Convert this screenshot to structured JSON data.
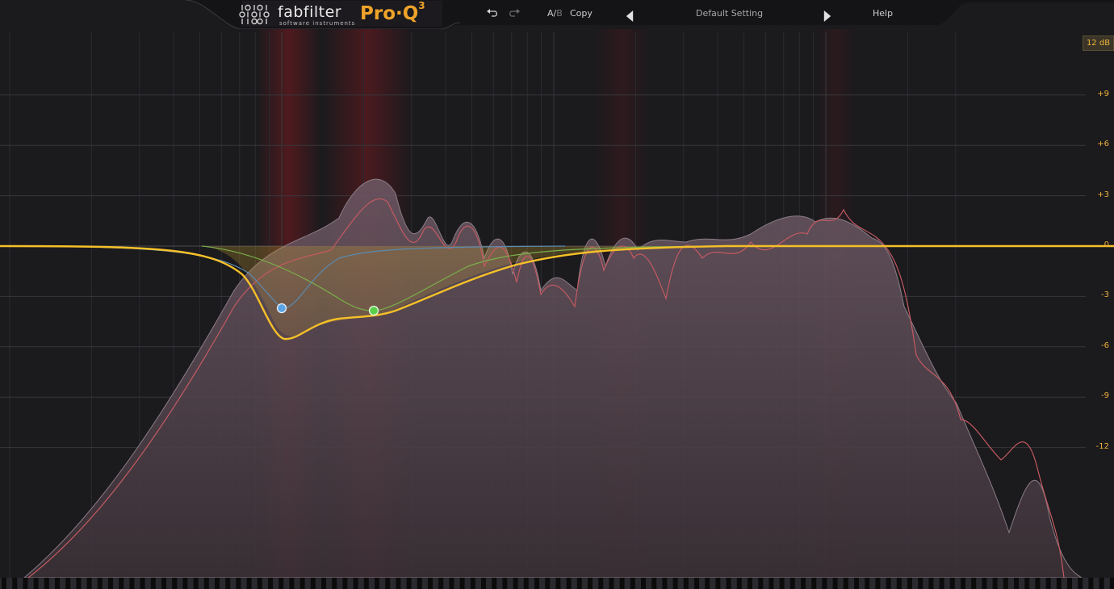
{
  "app": {
    "brand": "fabfilter",
    "brand_sub": "software instruments",
    "product": "Pro·Q",
    "product_version": "3"
  },
  "toolbar": {
    "undo_icon": "undo-icon",
    "redo_icon": "redo-icon",
    "ab_a": "A/",
    "ab_b": "B",
    "copy_label": "Copy",
    "preset_name": "Default Setting",
    "help_label": "Help"
  },
  "scale": {
    "range_label": "12 dB",
    "ticks": [
      {
        "label": "+9",
        "db": 9
      },
      {
        "label": "+6",
        "db": 6
      },
      {
        "label": "+3",
        "db": 3
      },
      {
        "label": "0",
        "db": 0
      },
      {
        "label": "-3",
        "db": -3
      },
      {
        "label": "-6",
        "db": -6
      },
      {
        "label": "-9",
        "db": -9
      },
      {
        "label": "-12",
        "db": -12
      }
    ]
  },
  "bands": [
    {
      "id": 1,
      "color": "#5aa4e6",
      "freq_hz": 70,
      "gain_db": -3.7
    },
    {
      "id": 2,
      "color": "#5ad04a",
      "freq_hz": 160,
      "gain_db": -3.9
    }
  ],
  "colors": {
    "eq_curve": "#f5c028",
    "spectrum_post": "#c45a62",
    "spectrum_pre": "#9a8f98",
    "collision_highlight": "#8a1e24",
    "accent": "#f0a32a"
  }
}
